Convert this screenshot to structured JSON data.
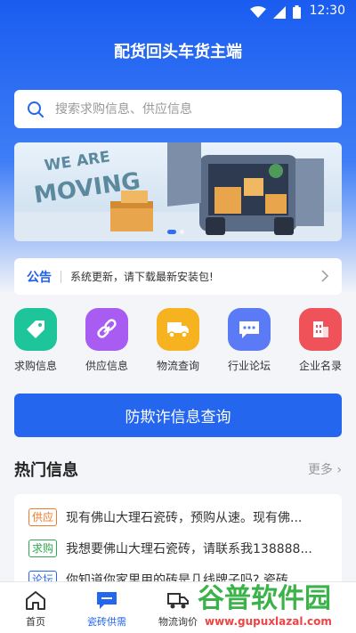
{
  "status": {
    "time": "12:30"
  },
  "header": {
    "title": "配货回头车货主端"
  },
  "search": {
    "placeholder": "搜索求购信息、供应信息"
  },
  "banner": {
    "line1": "WE ARE",
    "line2": "MOVING"
  },
  "notice": {
    "label": "公告",
    "text": "系统更新，请下载最新安装包!"
  },
  "categories": [
    {
      "label": "求购信息",
      "color": "#1fc59a"
    },
    {
      "label": "供应信息",
      "color": "#a85cf2"
    },
    {
      "label": "物流查询",
      "color": "#f7b21f"
    },
    {
      "label": "行业论坛",
      "color": "#5b7bf6"
    },
    {
      "label": "企业名录",
      "color": "#f0525a"
    }
  ],
  "cta": {
    "label": "防欺诈信息查询"
  },
  "hot": {
    "title": "热门信息",
    "more": "更多 ›",
    "items": [
      {
        "tag": "供应",
        "tag_color": "#f0792a",
        "text": "现有佛山大理石瓷砖，预购从速。现有佛..."
      },
      {
        "tag": "求购",
        "tag_color": "#2fa84f",
        "text": "我想要佛山大理石瓷砖，请联系我138888..."
      },
      {
        "tag": "论坛",
        "tag_color": "#2566ef",
        "text": "你知道你家里用的砖是几线牌子吗? 瓷砖..."
      }
    ]
  },
  "tabbar": [
    {
      "label": "首页"
    },
    {
      "label": "瓷砖供需"
    },
    {
      "label": "物流询价"
    },
    {
      "label": ""
    },
    {
      "label": ""
    }
  ],
  "watermark": {
    "line1": "谷普软件园",
    "line2": "www.gupuxlazal.com"
  }
}
